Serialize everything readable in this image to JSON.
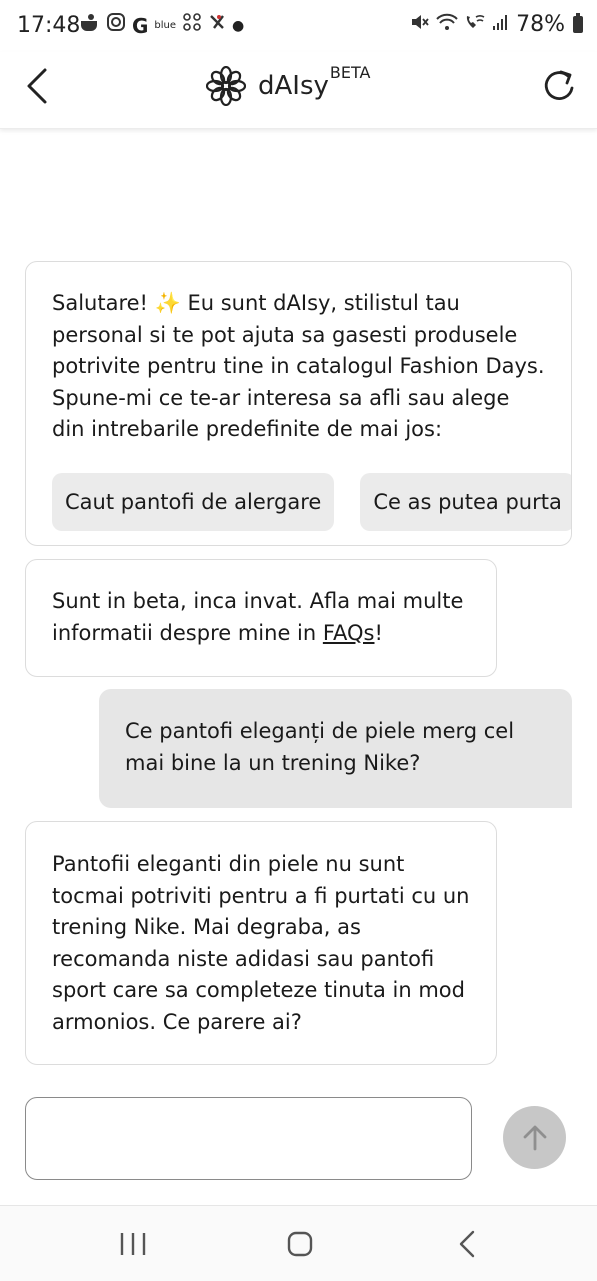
{
  "status_bar": {
    "time": "17:48",
    "notif_blue_text": "blue",
    "battery": "78%"
  },
  "header": {
    "brand_name": "dAIsy",
    "brand_badge": "BETA"
  },
  "chat": {
    "welcome_message": "Salutare! ✨ Eu sunt dAIsy, stilistul tau personal si te pot ajuta sa gasesti produsele potrivite pentru tine in catalogul Fashion Days. Spune-mi ce te-ar interesa sa afli sau alege din intrebarile predefinite de mai jos:",
    "suggestions": [
      "Caut pantofi de alergare",
      "Ce as putea purta"
    ],
    "beta_notice_text": "Sunt in beta, inca invat. Afla mai multe informatii despre mine in ",
    "beta_notice_link": "FAQs",
    "beta_notice_end": "!",
    "user_message": "Ce pantofi eleganți de piele merg cel mai bine la un trening Nike?",
    "bot_reply": "Pantofii eleganti din piele nu sunt tocmai potriviti pentru a fi purtati cu un trening Nike. Mai degraba, as recomanda niste adidasi sau pantofi sport care sa completeze tinuta in mod armonios. Ce parere ai?"
  },
  "composer": {
    "value": "",
    "placeholder": ""
  },
  "colors": {
    "user_bubble": "#e6e6e6",
    "chip_bg": "#ebebeb",
    "send_button": "#c7c7c7"
  },
  "icons": {
    "back": "chevron-left-icon",
    "refresh": "refresh-icon",
    "logo": "daisy-flower-icon",
    "send": "arrow-up-icon",
    "nav_recents": "recents-icon",
    "nav_home": "home-icon",
    "nav_back": "nav-back-icon"
  }
}
